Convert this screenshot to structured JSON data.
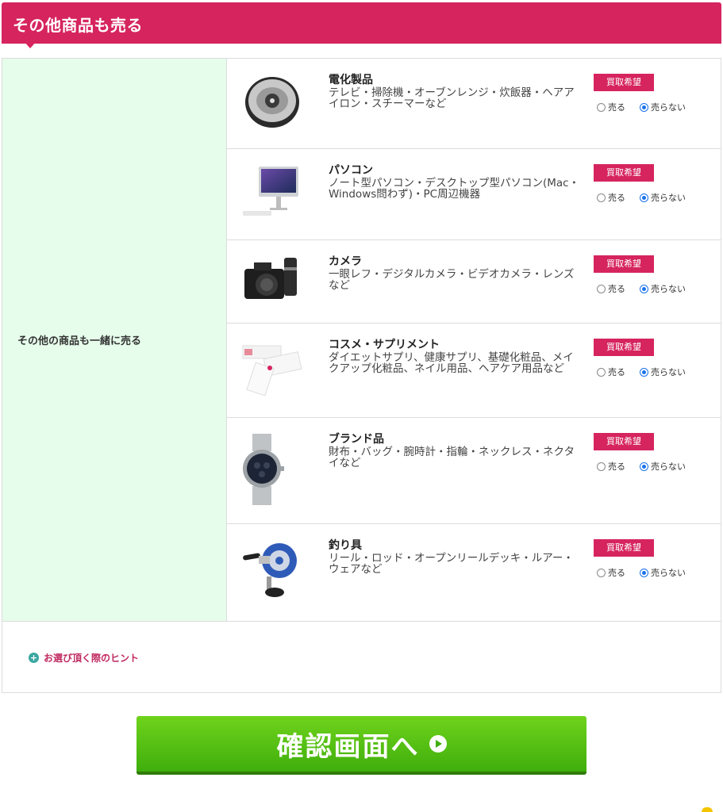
{
  "header": {
    "title": "その他商品も売る"
  },
  "left_label": "その他の商品も一緒に売る",
  "badge_label": "買取希望",
  "radio_labels": {
    "sell": "売る",
    "no_sell": "売らない"
  },
  "items": [
    {
      "title": "電化製品",
      "description": "テレビ・掃除機・オーブンレンジ・炊飯器・ヘアアイロン・スチーマーなど",
      "icon": "robot-vacuum-icon",
      "selected": "売らない"
    },
    {
      "title": "パソコン",
      "description": "ノート型パソコン・デスクトップ型パソコン(Mac・Windows問わず)・PC周辺機器",
      "icon": "desktop-computer-icon",
      "selected": "売らない"
    },
    {
      "title": "カメラ",
      "description": "一眼レフ・デジタルカメラ・ビデオカメラ・レンズなど",
      "icon": "camera-icon",
      "selected": "売らない"
    },
    {
      "title": "コスメ・サプリメント",
      "description": "ダイエットサプリ、健康サプリ、基礎化粧品、メイクアップ化粧品、ネイル用品、ヘアケア用品など",
      "icon": "cosmetics-icon",
      "selected": "売らない"
    },
    {
      "title": "ブランド品",
      "description": "財布・バッグ・腕時計・指輪・ネックレス・ネクタイなど",
      "icon": "watch-icon",
      "selected": "売らない"
    },
    {
      "title": "釣り具",
      "description": "リール・ロッド・オープンリールデッキ・ルアー・ウェアなど",
      "icon": "fishing-reel-icon",
      "selected": "売らない"
    }
  ],
  "hint": {
    "label": "お選び頂く際のヒント"
  },
  "confirm": {
    "label": "確認画面へ"
  },
  "colors": {
    "accent": "#d6245f",
    "left_bg": "#e6fdeb",
    "button": "#4dbd10"
  }
}
